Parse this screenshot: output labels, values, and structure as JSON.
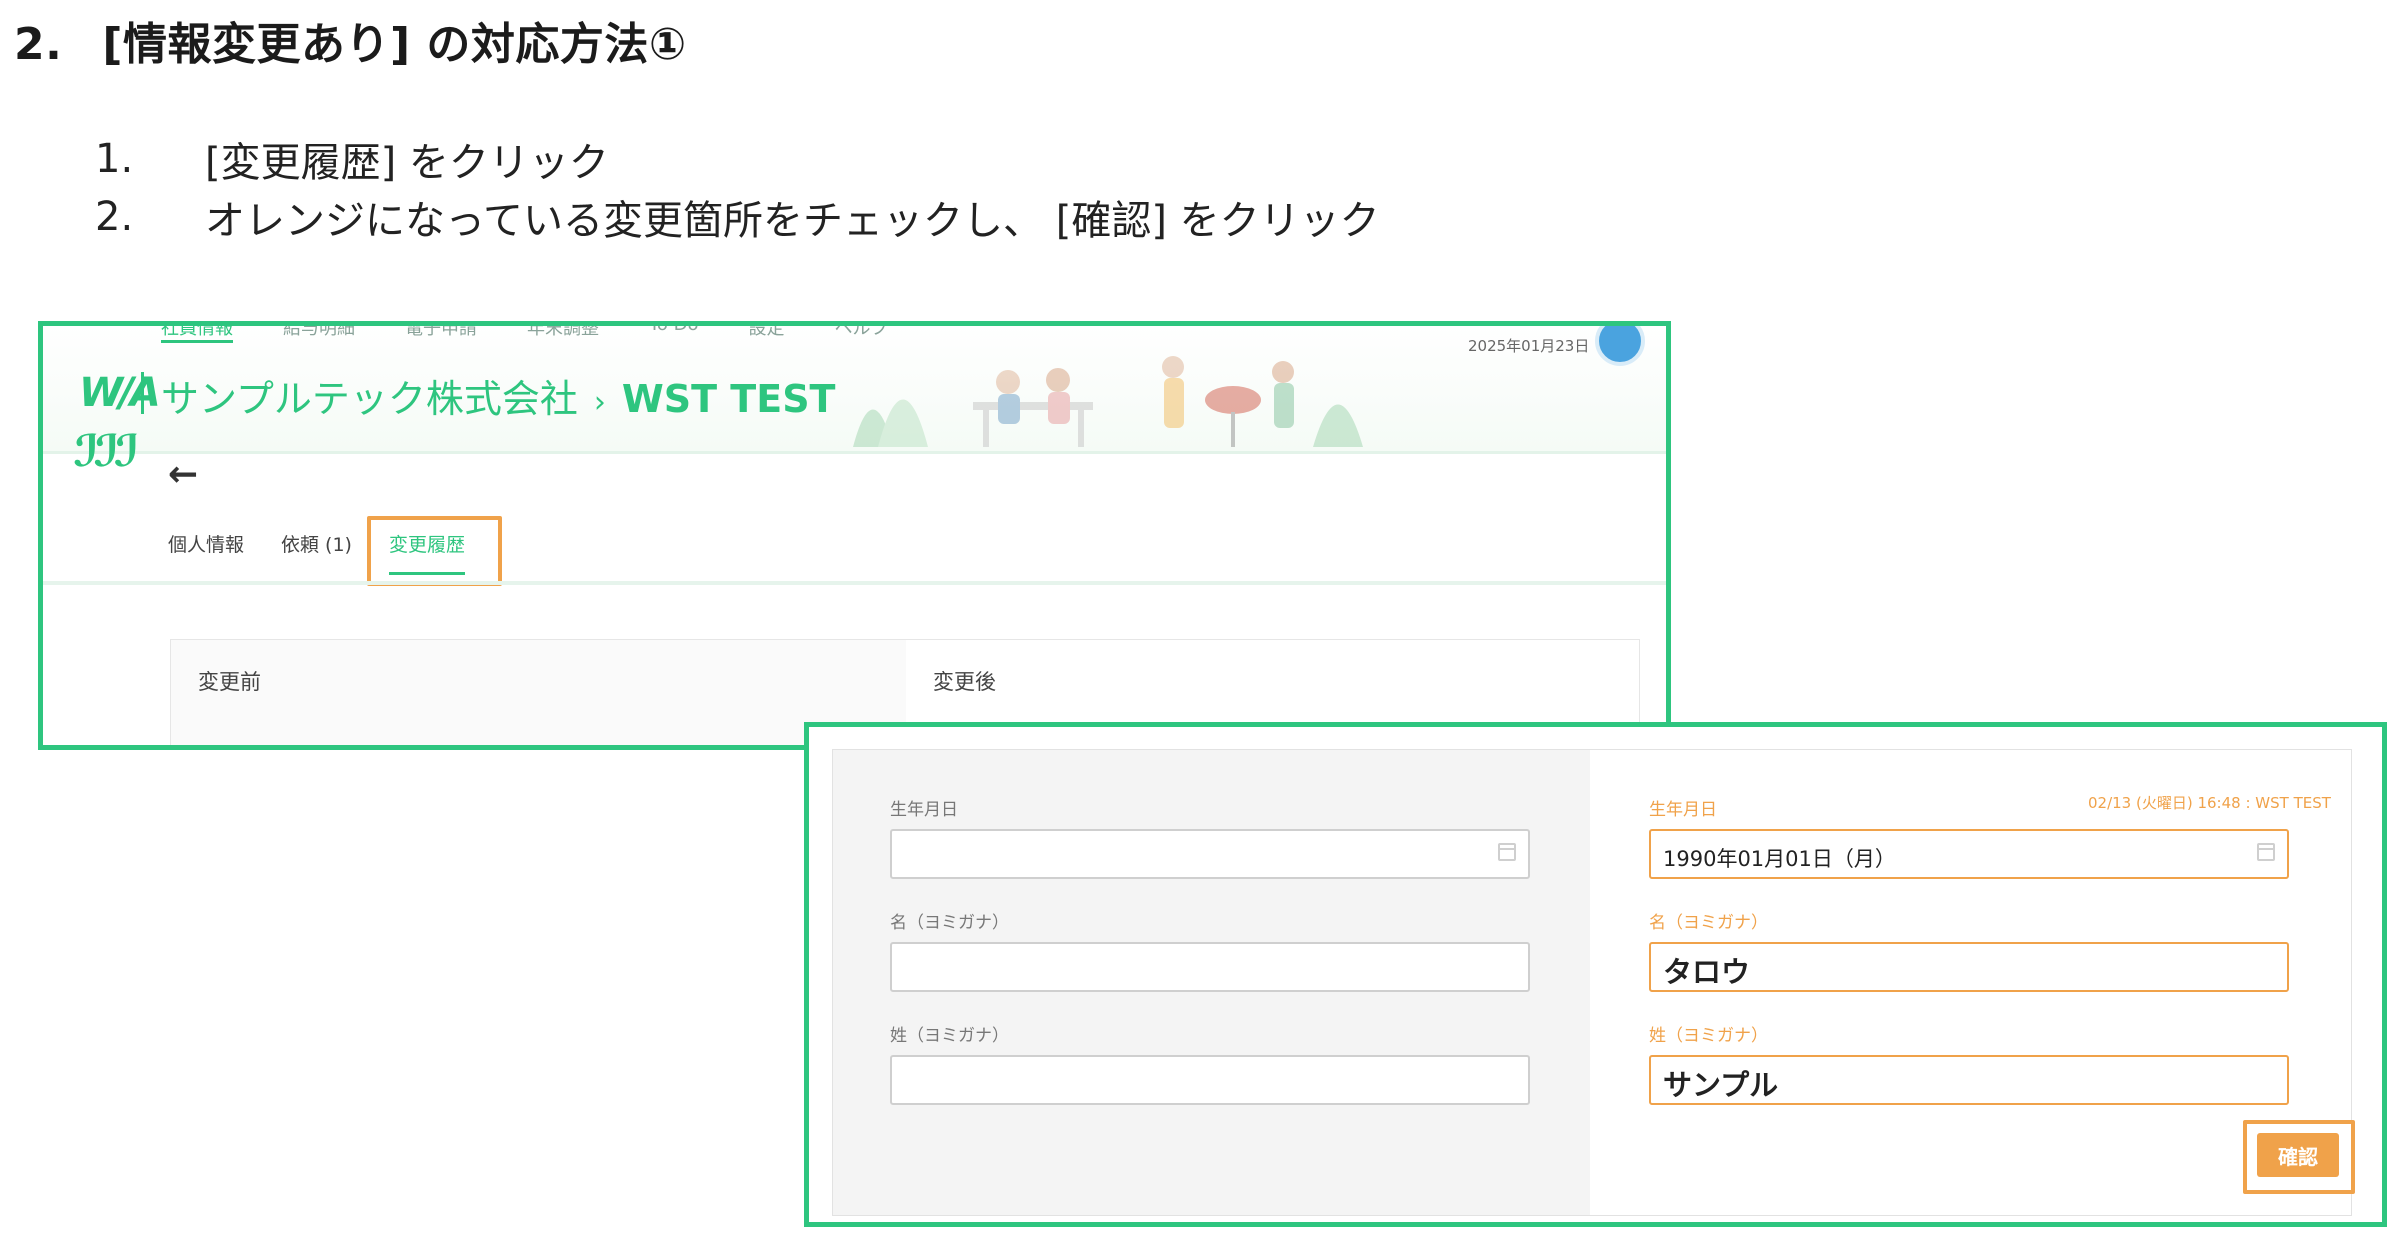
{
  "heading": {
    "number": "2.",
    "text": "[情報変更あり] の対応方法①"
  },
  "steps": [
    {
      "n": "1.",
      "text": " [変更履歴] をクリック"
    },
    {
      "n": "2.",
      "text": "オレンジになっている変更箇所をチェックし、 [確認] をクリック"
    }
  ],
  "app": {
    "nav": [
      "社員情報",
      "給与明細",
      "電子申請",
      "年末調整",
      "To Do",
      "設定",
      "ヘルプ"
    ],
    "logo": "W/A",
    "mark": "ℐℐℐ",
    "company": "サンプルテック株式会社",
    "separator": "›",
    "user": "WST TEST",
    "date": "2025年01月23日",
    "back_arrow": "←",
    "tabs": [
      "個人情報",
      "依頼 (1)",
      "変更履歴"
    ],
    "before_label": "変更前",
    "after_label": "変更後"
  },
  "detail": {
    "timestamp": "02/13 (火曜日) 16:48 : WST TEST",
    "before": {
      "birth_label": "生年月日",
      "birth_value": "",
      "first_label": "名（ヨミガナ）",
      "first_value": "",
      "last_label": "姓（ヨミガナ）",
      "last_value": ""
    },
    "after": {
      "birth_label": "生年月日",
      "birth_value": "1990年01月01日（月）",
      "first_label": "名（ヨミガナ）",
      "first_value": "タロウ",
      "last_label": "姓（ヨミガナ）",
      "last_value": "サンプル"
    },
    "confirm_label": "確認"
  },
  "colors": {
    "brand_green": "#2ec57f",
    "highlight_orange": "#f0a24a"
  }
}
